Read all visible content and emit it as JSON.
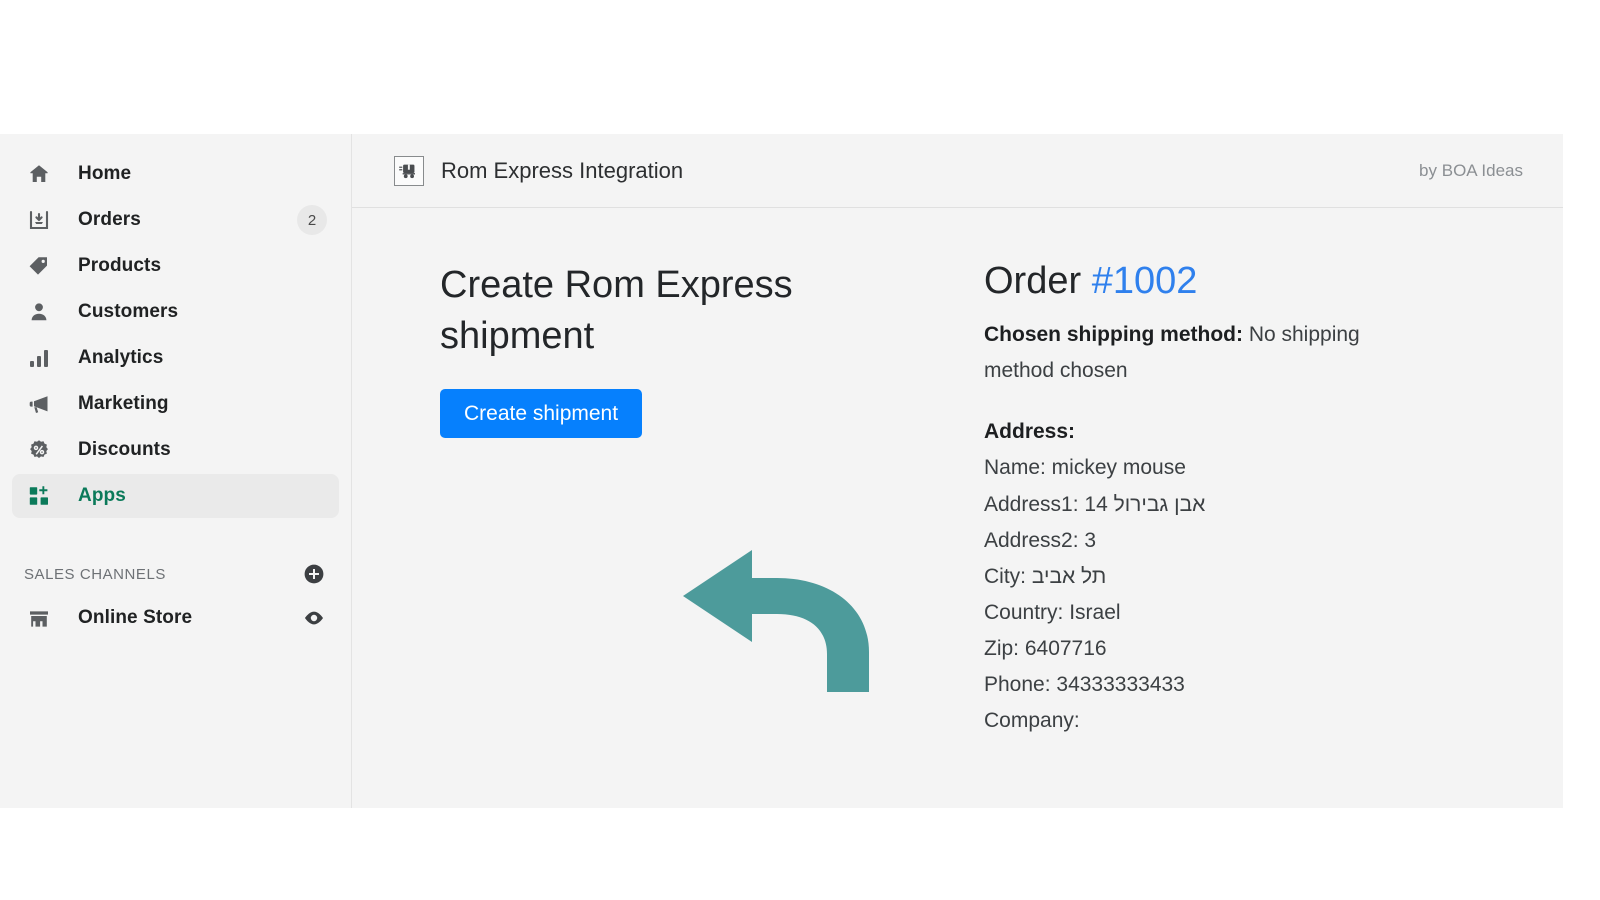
{
  "sidebar": {
    "items": [
      {
        "label": "Home",
        "icon": "home-icon",
        "badge": null,
        "active": false
      },
      {
        "label": "Orders",
        "icon": "orders-inbox-icon",
        "badge": "2",
        "active": false
      },
      {
        "label": "Products",
        "icon": "product-tag-icon",
        "badge": null,
        "active": false
      },
      {
        "label": "Customers",
        "icon": "customer-person-icon",
        "badge": null,
        "active": false
      },
      {
        "label": "Analytics",
        "icon": "analytics-bars-icon",
        "badge": null,
        "active": false
      },
      {
        "label": "Marketing",
        "icon": "marketing-megaphone-icon",
        "badge": null,
        "active": false
      },
      {
        "label": "Discounts",
        "icon": "discount-percent-icon",
        "badge": null,
        "active": false
      },
      {
        "label": "Apps",
        "icon": "apps-grid-plus-icon",
        "badge": null,
        "active": true
      }
    ],
    "sales_channels": {
      "title": "SALES CHANNELS",
      "add_icon": "plus-circle-icon",
      "channels": [
        {
          "label": "Online Store",
          "icon": "storefront-icon",
          "action_icon": "eye-icon"
        }
      ]
    }
  },
  "app": {
    "icon": "delivery-truck-icon",
    "title": "Rom Express Integration",
    "author": "by BOA Ideas"
  },
  "main": {
    "heading": "Create Rom Express shipment",
    "create_shipment_label": "Create shipment",
    "annotation_icon": "curved-left-arrow-icon"
  },
  "order": {
    "title_prefix": "Order ",
    "number": "#1002",
    "shipping_method_label": "Chosen shipping method:",
    "shipping_method_value": " No shipping method chosen",
    "address_heading": "Address:",
    "address_lines": [
      "Name: mickey mouse",
      "Address1: 14 אבן גבירול",
      "Address2: 3",
      "City: תל אביב",
      "Country: Israel",
      "Zip: 6407716",
      "Phone: 34333333433",
      "Company:"
    ]
  },
  "colors": {
    "accent_blue": "#0680fd",
    "link_blue": "#2f80ed",
    "active_green": "#0b7a5a",
    "annotation_teal": "#4d9b9b",
    "surface": "#f4f4f4"
  }
}
